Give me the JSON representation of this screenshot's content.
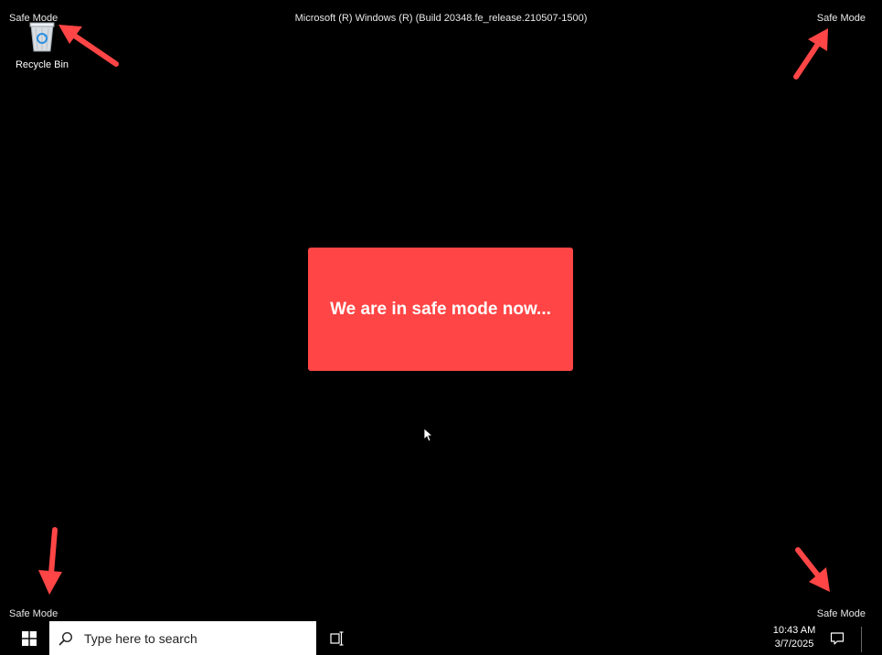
{
  "desktop": {
    "safe_mode_label": "Safe Mode",
    "build_string": "Microsoft (R) Windows (R) (Build 20348.fe_release.210507-1500)",
    "icons": [
      {
        "label": "Recycle Bin",
        "icon": "recycle-bin-icon"
      }
    ],
    "banner": {
      "text": "We are in safe mode now...",
      "color": "#ff4545"
    },
    "annotation_color": "#ff4545"
  },
  "taskbar": {
    "start_icon": "windows-logo-icon",
    "search_placeholder": "Type here to search",
    "task_view_icon": "task-view-icon",
    "time": "10:43 AM",
    "date": "3/7/2025",
    "notification_icon": "action-center-icon"
  }
}
